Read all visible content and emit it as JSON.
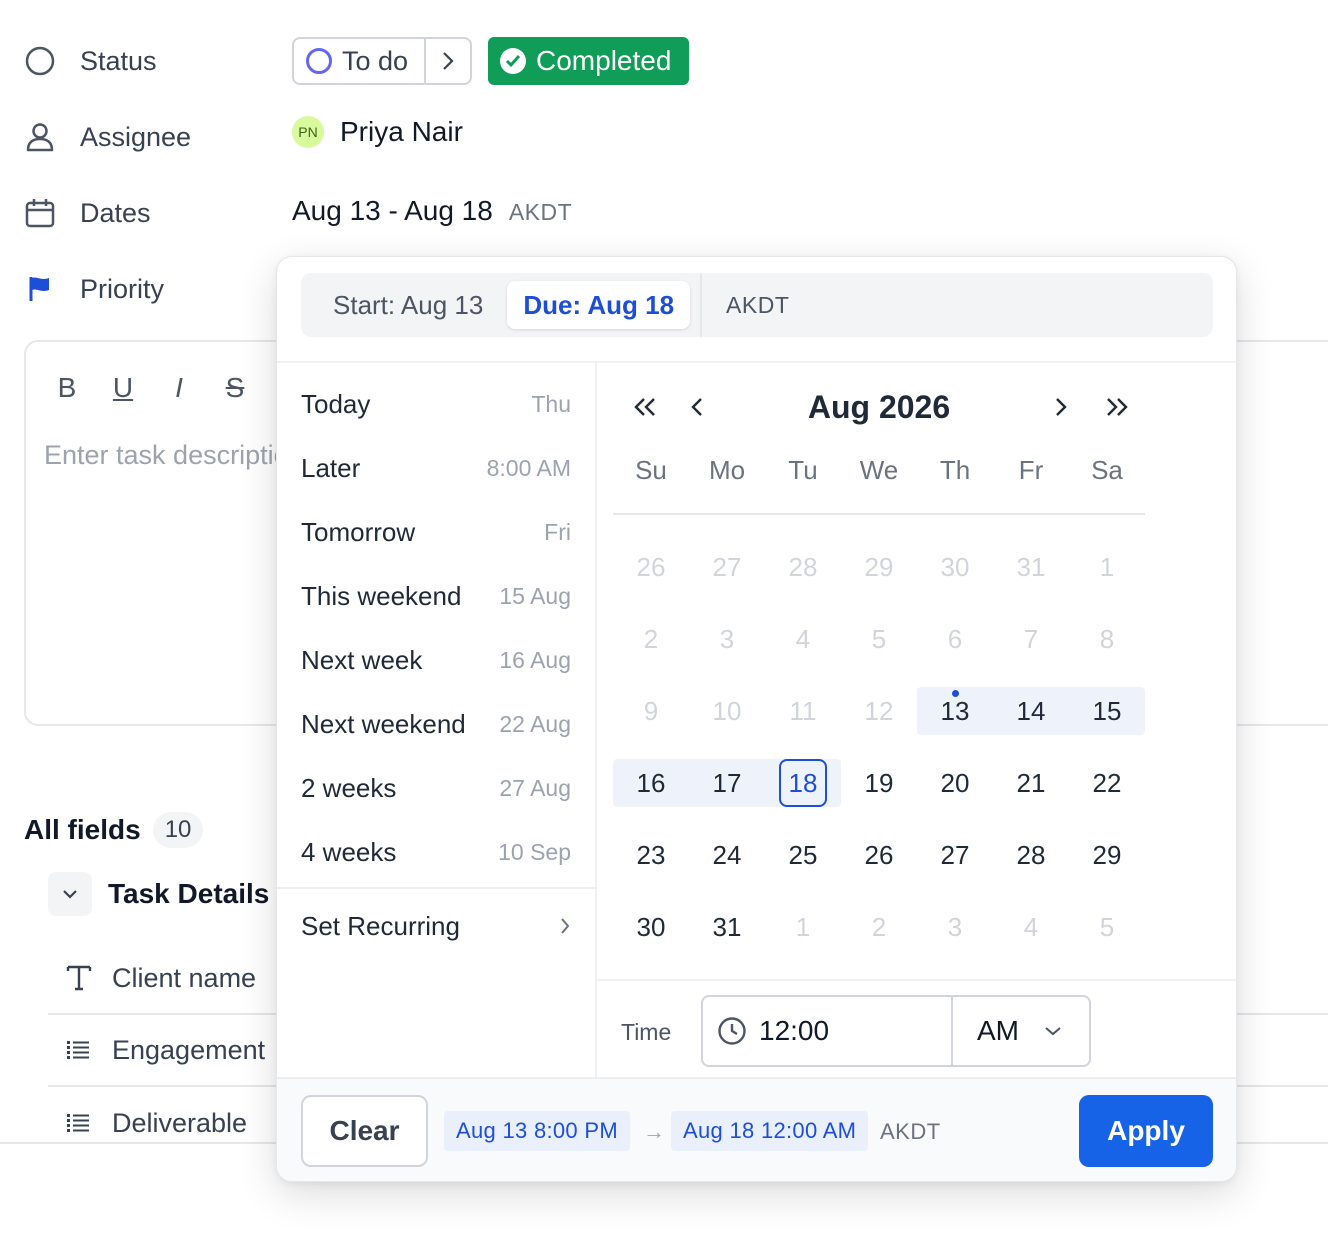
{
  "fields": {
    "status_label": "Status",
    "assignee_label": "Assignee",
    "dates_label": "Dates",
    "priority_label": "Priority"
  },
  "status": {
    "current": "To do",
    "next": "Completed",
    "next_color": "#0f9d58"
  },
  "assignee": {
    "initials": "PN",
    "name": "Priya Nair"
  },
  "dates": {
    "range": "Aug 13 - Aug 18",
    "tz": "AKDT"
  },
  "editor": {
    "toolbar": [
      "B",
      "U",
      "I",
      "S"
    ],
    "placeholder": "Enter task description"
  },
  "all_fields": {
    "title": "All fields",
    "count": "10"
  },
  "task_details": {
    "title": "Task Details",
    "fields": [
      {
        "icon": "text-field-icon",
        "label": "Client name"
      },
      {
        "icon": "list-field-icon",
        "label": "Engagement"
      },
      {
        "icon": "list-field-icon",
        "label": "Deliverable"
      }
    ]
  },
  "popover": {
    "start_tab": "Start: Aug 13",
    "due_tab": "Due: Aug 18",
    "tz": "AKDT",
    "quick_options": [
      {
        "label": "Today",
        "value": "Thu"
      },
      {
        "label": "Later",
        "value": "8:00 AM"
      },
      {
        "label": "Tomorrow",
        "value": "Fri"
      },
      {
        "label": "This weekend",
        "value": "15 Aug"
      },
      {
        "label": "Next week",
        "value": "16 Aug"
      },
      {
        "label": "Next weekend",
        "value": "22 Aug"
      },
      {
        "label": "2 weeks",
        "value": "27 Aug"
      },
      {
        "label": "4 weeks",
        "value": "10 Sep"
      }
    ],
    "recurring_label": "Set Recurring",
    "calendar": {
      "month_label": "Aug 2026",
      "weekdays": [
        "Su",
        "Mo",
        "Tu",
        "We",
        "Th",
        "Fr",
        "Sa"
      ],
      "weeks": [
        [
          "26",
          "27",
          "28",
          "29",
          "30",
          "31",
          "1"
        ],
        [
          "2",
          "3",
          "4",
          "5",
          "6",
          "7",
          "8"
        ],
        [
          "9",
          "10",
          "11",
          "12",
          "13",
          "14",
          "15"
        ],
        [
          "16",
          "17",
          "18",
          "19",
          "20",
          "21",
          "22"
        ],
        [
          "23",
          "24",
          "25",
          "26",
          "27",
          "28",
          "29"
        ],
        [
          "30",
          "31",
          "1",
          "2",
          "3",
          "4",
          "5"
        ]
      ],
      "range_start": "13",
      "range_end": "18",
      "today": "13"
    },
    "time_label": "Time",
    "time_value": "12:00",
    "ampm": "AM",
    "footer": {
      "clear": "Clear",
      "start_chip": "Aug 13 8:00 PM",
      "end_chip": "Aug 18 12:00 AM",
      "tz": "AKDT",
      "apply": "Apply"
    }
  }
}
